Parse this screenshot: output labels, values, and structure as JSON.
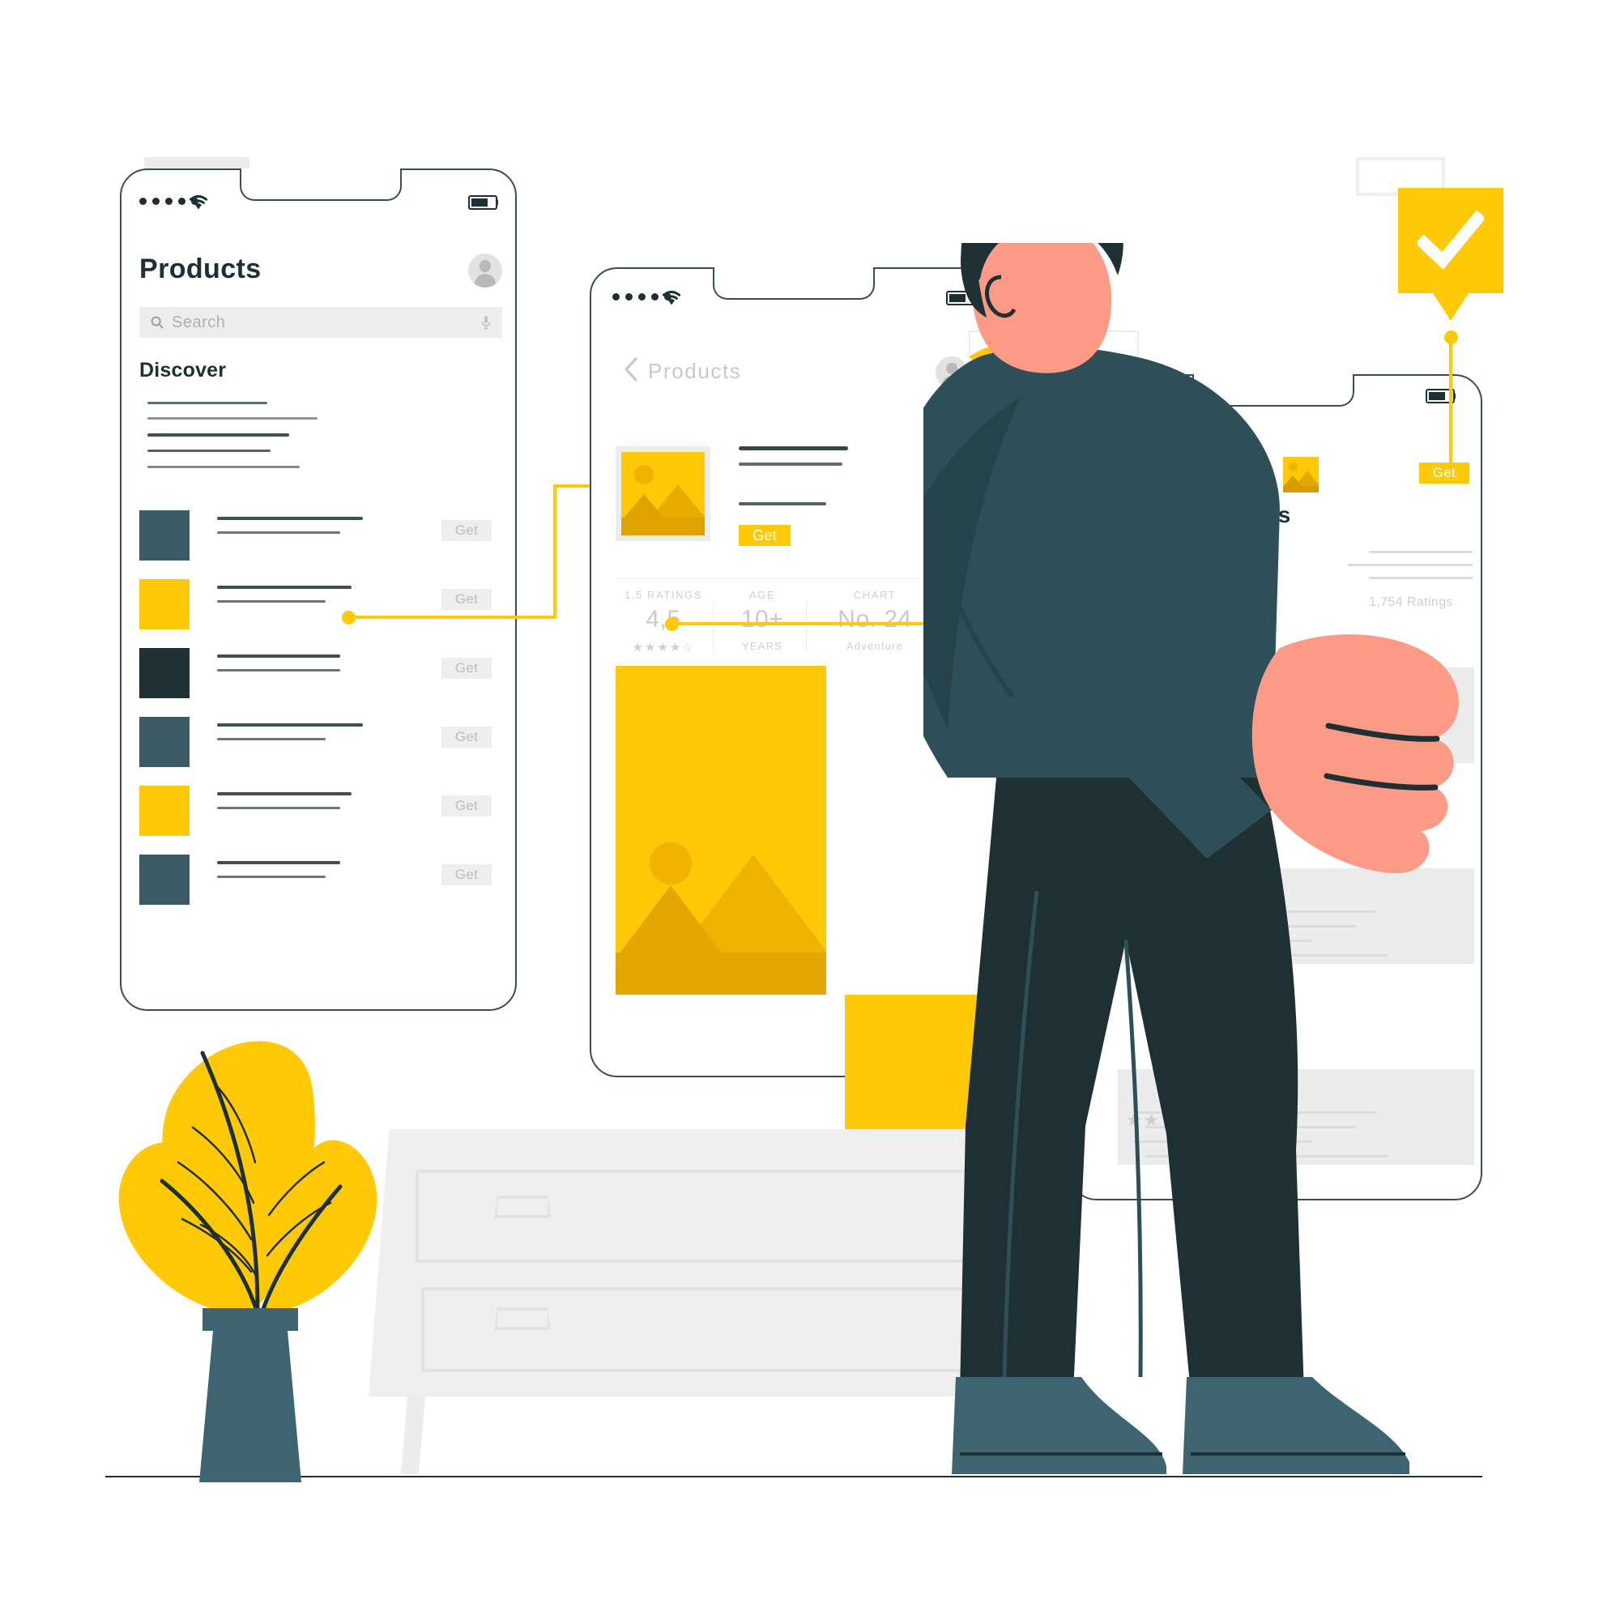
{
  "meta": {
    "scene_title": "App store product browsing illustration",
    "accent_yellow": "#ffc907",
    "accent_yellow_dark": "#e0a800",
    "dark_navy": "#1f3035",
    "teal": "#3b5a63",
    "teal_light": "#3d6470",
    "skin": "#fb9a85",
    "grey_ui": "#ededed",
    "text_grey": "#c9c9c9"
  },
  "phone1": {
    "status": {
      "dots": 5,
      "wifi_icon": "wifi-icon",
      "battery_icon": "battery-icon",
      "battery_level": 70
    },
    "title": "Products",
    "avatar_icon": "account-avatar-icon",
    "search": {
      "placeholder": "Search",
      "icon": "search-icon",
      "mic_icon": "microphone-icon"
    },
    "section_title": "Discover",
    "list": [
      {
        "swatch": "#3b5a63",
        "action": "Get"
      },
      {
        "swatch": "#ffc907",
        "action": "Get"
      },
      {
        "swatch": "#1f3035",
        "action": "Get"
      },
      {
        "swatch": "#3b5a63",
        "action": "Get"
      },
      {
        "swatch": "#ffc907",
        "action": "Get"
      },
      {
        "swatch": "#3b5a63",
        "action": "Get"
      }
    ]
  },
  "phone2": {
    "status": {
      "dots": 5,
      "wifi_icon": "wifi-icon",
      "battery_icon": "battery-icon",
      "battery_level": 70
    },
    "back_icon": "chevron-left-icon",
    "title": "Products",
    "avatar_icon": "account-avatar-icon",
    "detail": {
      "thumbnail_icon": "image-placeholder-icon",
      "action": "Get"
    },
    "metrics": [
      {
        "label": "1,5 RATINGS",
        "value": "4,5",
        "sub": "★★★★☆",
        "sub_kind": "stars"
      },
      {
        "label": "AGE",
        "value": "10+",
        "sub": "YEARS",
        "sub_kind": "text"
      },
      {
        "label": "CHART",
        "value": "No. 24",
        "sub": "Adventure",
        "sub_kind": "text"
      }
    ],
    "screenshots": [
      {
        "name": "screenshot-1",
        "bg": "#ffc907"
      },
      {
        "name": "screenshot-2",
        "bg": "#ffc907"
      }
    ]
  },
  "phone3": {
    "status": {
      "wifi_icon": "wifi-icon",
      "battery_icon": "battery-icon",
      "battery_level": 70
    },
    "section_title": "Reviews",
    "thumbnail_icon": "image-placeholder-icon",
    "action": "Get",
    "ratings_count": "1,754 Ratings",
    "review_cards": 3,
    "stars": "★★★"
  },
  "tooltip": {
    "icon": "checkmark-icon",
    "color": "#ffc907"
  },
  "connectors": [
    {
      "name": "connector-phone1-to-phone2"
    },
    {
      "name": "connector-phone2-to-phone3"
    },
    {
      "name": "connector-tooltip-to-get"
    }
  ],
  "scenery": {
    "plant": {
      "name": "potted-plant",
      "leaf_color": "#ffc907",
      "pot_color": "#3d6470"
    },
    "dresser": {
      "name": "dresser",
      "drawers": 2,
      "color": "#efefef"
    },
    "person": {
      "name": "person-standing",
      "hair": "#1f3035",
      "hoodie": "#2f4f58",
      "pants": "#1f3035",
      "shoes": "#3d6470",
      "skin": "#fb9a85"
    }
  }
}
